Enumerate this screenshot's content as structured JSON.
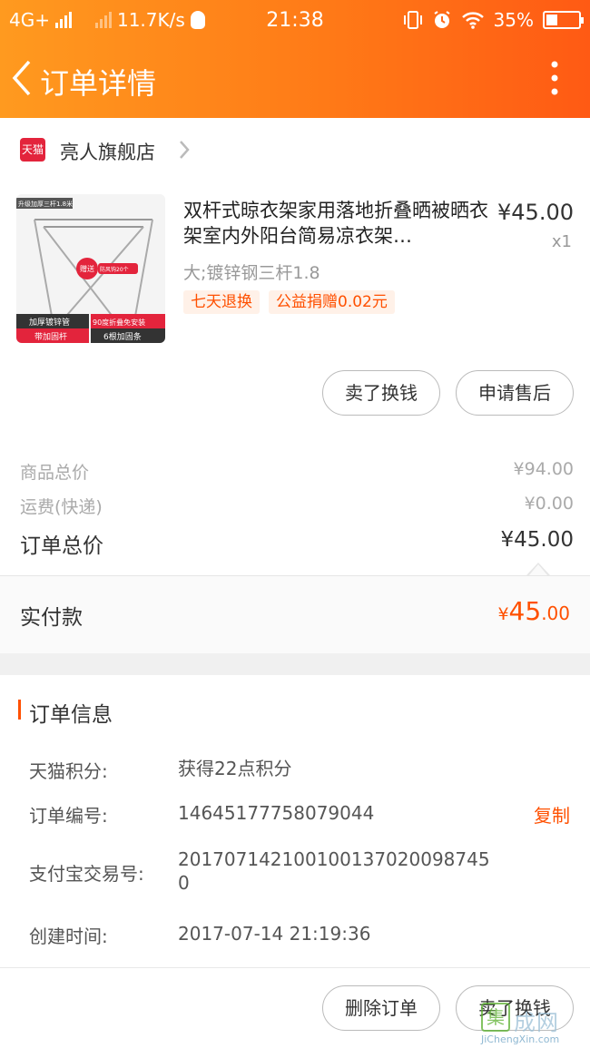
{
  "status_bar": {
    "network": "4G+",
    "speed": "11.7K/s",
    "time": "21:38",
    "battery": "35%",
    "battery_level": 0.35
  },
  "nav": {
    "title": "订单详情",
    "back_icon": "chevron-left-icon",
    "more_icon": "more-vertical-icon"
  },
  "shop": {
    "badge": "天猫",
    "name": "亮人旗舰店"
  },
  "product": {
    "title": "双杆式晾衣架家用落地折叠晒被晒衣架室内外阳台简易凉衣架…",
    "price": "¥45.00",
    "qty": "x1",
    "spec": "大;镀锌钢三杆1.8",
    "tags": [
      "七天退换",
      "公益捐赠0.02元"
    ],
    "image": {
      "top_label": "升级加厚三杆1.8米",
      "gift": "赠送",
      "gift_sub": "防风钩20个",
      "badges": [
        "加厚镀锌管",
        "90度折叠免安装",
        "带加固杆",
        "6根加固条"
      ]
    }
  },
  "actions": {
    "sell_label": "卖了换钱",
    "aftersale_label": "申请售后"
  },
  "summary": {
    "goods_label": "商品总价",
    "goods_value": "¥94.00",
    "shipping_label": "运费(快递)",
    "shipping_value": "¥0.00",
    "total_label": "订单总价",
    "total_value": "¥45.00",
    "paid_label": "实付款",
    "paid_currency": "¥",
    "paid_int": "45",
    "paid_dec": ".00"
  },
  "order_info": {
    "title": "订单信息",
    "points_label": "天猫积分:",
    "points_value": "获得22点积分",
    "order_no_label": "订单编号:",
    "order_no_value": "1464517775807904 4",
    "copy_label": "复制",
    "alipay_label": "支付宝交易号:",
    "alipay_value": "2017071421001001370200987450",
    "created_label": "创建时间:",
    "created_value": "2017-07-14 21:19:36"
  },
  "bottom": {
    "delete_label": "删除订单",
    "sell_label": "卖了换钱"
  },
  "watermark": {
    "mark": "集",
    "text": "成网",
    "en": "JiChengXin.com"
  },
  "colors": {
    "accent": "#ff5000",
    "header_start": "#ff9a1f",
    "header_end": "#ff5a14",
    "tmall": "#e3243c"
  }
}
